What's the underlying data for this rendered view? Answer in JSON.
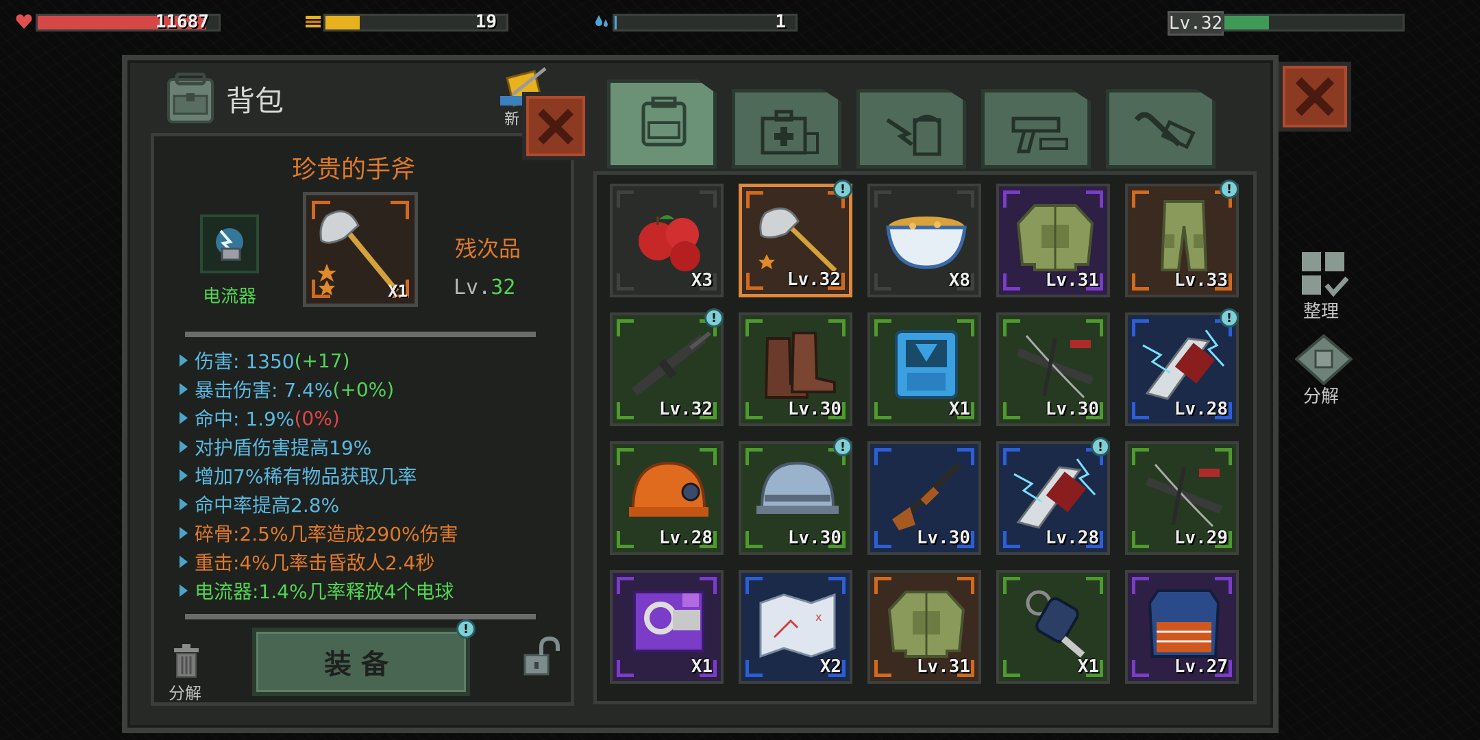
{
  "hud": {
    "health_value": "11687",
    "health_fill": 0.93,
    "food_value": "19",
    "food_fill": 0.19,
    "water_value": "1",
    "water_fill": 0.01,
    "player_level": "Lv.32",
    "xp_fill": 0.25,
    "colors": {
      "health": "#d64848",
      "food": "#e8b21e",
      "water": "#4fa6d6",
      "xp": "#3f9a55"
    }
  },
  "panel": {
    "title": "背包",
    "new_label": "新"
  },
  "detail": {
    "item_name": "珍贵的手斧",
    "quantity": "X1",
    "quality": "残次品",
    "level_prefix": "Lv.",
    "level_num": "32",
    "mod_name": "电流器",
    "stats": [
      {
        "label": "伤害: 1350",
        "bonus": " (+17)",
        "label_color": "blue",
        "bonus_color": "green"
      },
      {
        "label": "暴击伤害: 7.4%",
        "bonus": " (+0%)",
        "label_color": "blue",
        "bonus_color": "green"
      },
      {
        "label": "命中: 1.9%",
        "bonus": " (0%)",
        "label_color": "blue",
        "bonus_color": "red"
      },
      {
        "label": "对护盾伤害提高19%",
        "bonus": "",
        "label_color": "blue",
        "bonus_color": "blue"
      },
      {
        "label": "增加7%稀有物品获取几率",
        "bonus": "",
        "label_color": "blue",
        "bonus_color": "blue"
      },
      {
        "label": "命中率提高2.8%",
        "bonus": "",
        "label_color": "blue",
        "bonus_color": "blue"
      },
      {
        "label": "碎骨:2.5%几率造成290%伤害",
        "bonus": "",
        "label_color": "orange",
        "bonus_color": "orange"
      },
      {
        "label": "重击:4%几率击昏敌人2.4秒",
        "bonus": "",
        "label_color": "orange",
        "bonus_color": "orange"
      },
      {
        "label": "电流器:1.4%几率释放4个电球",
        "bonus": "",
        "label_color": "green",
        "bonus_color": "green"
      }
    ],
    "equip_label": "装备",
    "disassemble_label": "分解"
  },
  "sidebar": {
    "sort_label": "整理",
    "disassemble_label": "分解"
  },
  "grid": [
    {
      "name": "apples",
      "caption": "X3",
      "rarity": "gray",
      "badge": false
    },
    {
      "name": "hand-axe",
      "caption": "Lv.32",
      "rarity": "orange",
      "badge": true,
      "selected": true
    },
    {
      "name": "soup-bowl",
      "caption": "X8",
      "rarity": "gray",
      "badge": false
    },
    {
      "name": "tactical-jacket",
      "caption": "Lv.31",
      "rarity": "purple",
      "badge": false
    },
    {
      "name": "cargo-pants",
      "caption": "Lv.33",
      "rarity": "orange",
      "badge": true
    },
    {
      "name": "assault-rifle",
      "caption": "Lv.32",
      "rarity": "green",
      "badge": true
    },
    {
      "name": "combat-boots",
      "caption": "Lv.30",
      "rarity": "green",
      "badge": false
    },
    {
      "name": "blue-backpack",
      "caption": "X1",
      "rarity": "green",
      "badge": false
    },
    {
      "name": "crossbow",
      "caption": "Lv.30",
      "rarity": "green",
      "badge": false
    },
    {
      "name": "electric-chainsaw",
      "caption": "Lv.28",
      "rarity": "blue",
      "badge": true
    },
    {
      "name": "mining-helmet",
      "caption": "Lv.28",
      "rarity": "green",
      "badge": false
    },
    {
      "name": "military-helmet",
      "caption": "Lv.30",
      "rarity": "green",
      "badge": true
    },
    {
      "name": "shotgun",
      "caption": "Lv.30",
      "rarity": "blue",
      "badge": false
    },
    {
      "name": "electric-chainsaw",
      "caption": "Lv.28",
      "rarity": "blue",
      "badge": true
    },
    {
      "name": "crossbow",
      "caption": "Lv.29",
      "rarity": "green",
      "badge": false
    },
    {
      "name": "blueprint-module",
      "caption": "X1",
      "rarity": "purple",
      "badge": false
    },
    {
      "name": "treasure-map",
      "caption": "X2",
      "rarity": "blue",
      "badge": false
    },
    {
      "name": "tactical-jacket",
      "caption": "Lv.31",
      "rarity": "orange",
      "badge": false
    },
    {
      "name": "key-fob",
      "caption": "X1",
      "rarity": "green",
      "badge": false
    },
    {
      "name": "armor-vest",
      "caption": "Lv.27",
      "rarity": "purple",
      "badge": false
    }
  ],
  "rarity_colors": {
    "gray": "#3f423f",
    "green": "#4e9a2e",
    "blue": "#2c5fd6",
    "purple": "#7b3cc8",
    "orange": "#d26a1e"
  },
  "tabs": [
    "backpack-icon",
    "medkit-icon",
    "food-icon",
    "weapon-icon",
    "tools-icon"
  ]
}
